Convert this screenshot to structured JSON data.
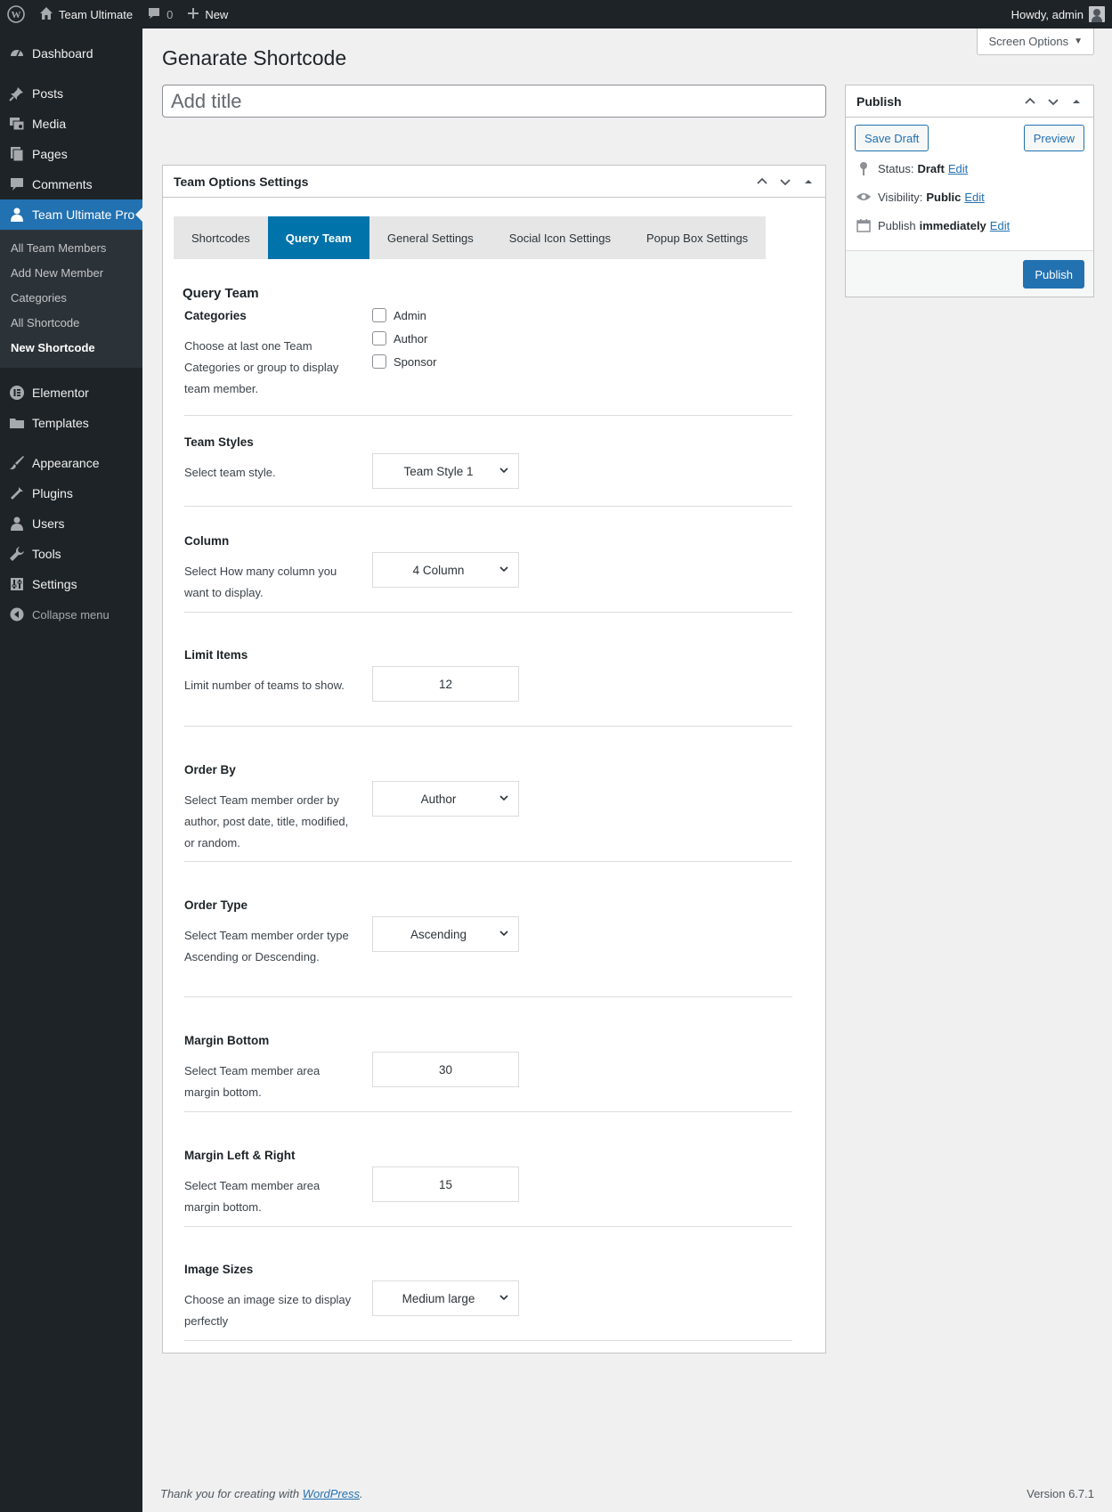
{
  "adminbar": {
    "site_name": "Team Ultimate",
    "comments_count": "0",
    "new_label": "New",
    "howdy": "Howdy, admin"
  },
  "sidebar": {
    "items": [
      {
        "label": "Dashboard",
        "icon": "dashboard-icon"
      },
      {
        "label": "Posts",
        "icon": "pin-icon"
      },
      {
        "label": "Media",
        "icon": "media-icon"
      },
      {
        "label": "Pages",
        "icon": "pages-icon"
      },
      {
        "label": "Comments",
        "icon": "comment-icon"
      },
      {
        "label": "Team Ultimate Pro",
        "icon": "user-icon"
      }
    ],
    "submenu": [
      "All Team Members",
      "Add New Member",
      "Categories",
      "All Shortcode",
      "New Shortcode"
    ],
    "items2": [
      {
        "label": "Elementor",
        "icon": "elementor-icon"
      },
      {
        "label": "Templates",
        "icon": "folder-icon"
      }
    ],
    "items3": [
      {
        "label": "Appearance",
        "icon": "brush-icon"
      },
      {
        "label": "Plugins",
        "icon": "plugin-icon"
      },
      {
        "label": "Users",
        "icon": "users-icon"
      },
      {
        "label": "Tools",
        "icon": "wrench-icon"
      },
      {
        "label": "Settings",
        "icon": "settings-icon"
      }
    ],
    "collapse": "Collapse menu"
  },
  "screen_options": "Screen Options",
  "page_title": "Genarate Shortcode",
  "title_placeholder": "Add title",
  "team_options": {
    "header": "Team Options Settings",
    "tabs": [
      "Shortcodes",
      "Query Team",
      "General Settings",
      "Social Icon Settings",
      "Popup Box Settings"
    ],
    "active_tab": "Query Team",
    "section_title": "Query Team",
    "fields": {
      "categories": {
        "label": "Categories",
        "desc": "Choose at last one Team Categories or group to display team member.",
        "options": [
          "Admin",
          "Author",
          "Sponsor"
        ]
      },
      "team_styles": {
        "label": "Team Styles",
        "desc": "Select team style.",
        "value": "Team Style 1"
      },
      "column": {
        "label": "Column",
        "desc": "Select How many column you want to display.",
        "value": "4 Column"
      },
      "limit_items": {
        "label": "Limit Items",
        "desc": "Limit number of teams to show.",
        "value": "12"
      },
      "order_by": {
        "label": "Order By",
        "desc": "Select Team member order by author, post date, title, modified, or random.",
        "value": "Author"
      },
      "order_type": {
        "label": "Order Type",
        "desc": "Select Team member order type Ascending or Descending.",
        "value": "Ascending"
      },
      "margin_bottom": {
        "label": "Margin Bottom",
        "desc": "Select Team member area margin bottom.",
        "value": "30"
      },
      "margin_lr": {
        "label": "Margin Left & Right",
        "desc": "Select Team member area margin bottom.",
        "value": "15"
      },
      "image_sizes": {
        "label": "Image Sizes",
        "desc": "Choose an image size to display perfectly",
        "value": "Medium large"
      }
    }
  },
  "publish": {
    "header": "Publish",
    "save_draft": "Save Draft",
    "preview": "Preview",
    "status_label": "Status:",
    "status_value": "Draft",
    "visibility_label": "Visibility:",
    "visibility_value": "Public",
    "publish_label": "Publish",
    "publish_value": "immediately",
    "edit": "Edit",
    "publish_button": "Publish"
  },
  "footer": {
    "thanks_prefix": "Thank you for creating with ",
    "wordpress": "WordPress",
    "thanks_suffix": ".",
    "version": "Version 6.7.1"
  },
  "colors": {
    "accent": "#2271b1",
    "tab_active": "#0073aa",
    "sidebar_bg": "#1d2327"
  }
}
